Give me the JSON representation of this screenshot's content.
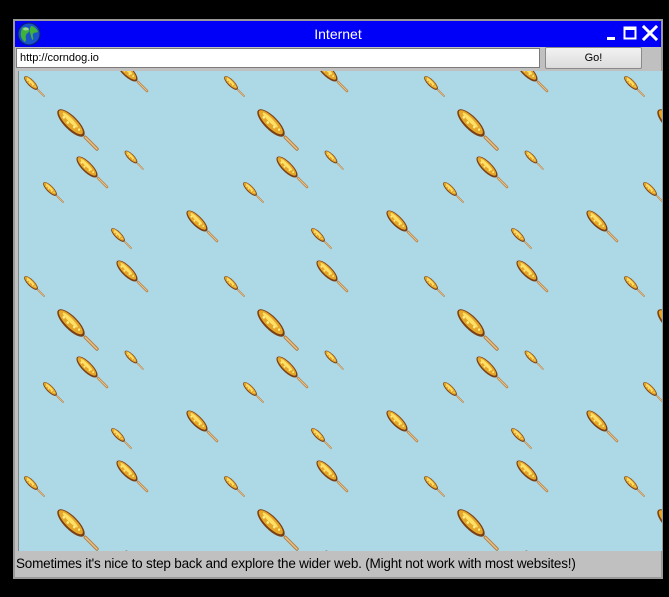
{
  "window": {
    "title": "Internet",
    "controls": {
      "minimize": "minimize-icon",
      "maximize": "maximize-icon",
      "close": "close-icon"
    },
    "icon": "globe-icon"
  },
  "address_bar": {
    "url": "http://corndog.io",
    "go_label": "Go!"
  },
  "page": {
    "background_color": "#add8e6",
    "pattern_icon": "corndog-icon"
  },
  "status": {
    "text": "Sometimes it's nice to step back and explore the wider web. (Might not work with most websites!)"
  },
  "colors": {
    "titlebar": "#0000f8",
    "chrome": "#c0c0c0",
    "screen_bg": "#000000"
  }
}
